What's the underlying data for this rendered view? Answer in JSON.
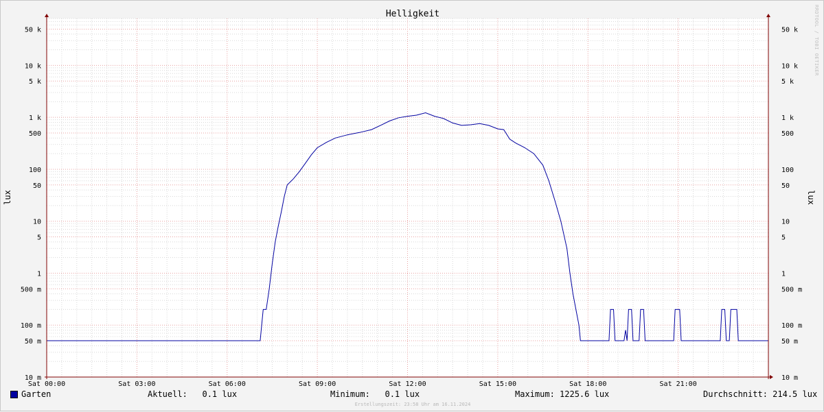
{
  "chart_data": {
    "type": "line",
    "title": "Helligkeit",
    "ylabel": "lux",
    "y_scale": "log",
    "ylim": [
      0.01,
      80000
    ],
    "xlim_hours": [
      0,
      24
    ],
    "x_ticks": [
      {
        "hour": 0,
        "label": "Sat 00:00"
      },
      {
        "hour": 3,
        "label": "Sat 03:00"
      },
      {
        "hour": 6,
        "label": "Sat 06:00"
      },
      {
        "hour": 9,
        "label": "Sat 09:00"
      },
      {
        "hour": 12,
        "label": "Sat 12:00"
      },
      {
        "hour": 15,
        "label": "Sat 15:00"
      },
      {
        "hour": 18,
        "label": "Sat 18:00"
      },
      {
        "hour": 21,
        "label": "Sat 21:00"
      }
    ],
    "y_ticks": [
      {
        "value": 50000,
        "label": "50 k"
      },
      {
        "value": 10000,
        "label": "10 k"
      },
      {
        "value": 5000,
        "label": "5 k"
      },
      {
        "value": 1000,
        "label": "1 k"
      },
      {
        "value": 500,
        "label": "500"
      },
      {
        "value": 100,
        "label": "100"
      },
      {
        "value": 50,
        "label": "50"
      },
      {
        "value": 10,
        "label": "10"
      },
      {
        "value": 5,
        "label": "5"
      },
      {
        "value": 1,
        "label": "1"
      },
      {
        "value": 0.5,
        "label": "500 m"
      },
      {
        "value": 0.1,
        "label": "100 m"
      },
      {
        "value": 0.05,
        "label": "50 m"
      },
      {
        "value": 0.01,
        "label": "10 m"
      }
    ],
    "grid": true,
    "series": [
      {
        "name": "Garten",
        "color": "#0000a0",
        "points": [
          [
            0.0,
            0.05
          ],
          [
            7.1,
            0.05
          ],
          [
            7.15,
            0.1
          ],
          [
            7.2,
            0.2
          ],
          [
            7.3,
            0.2
          ],
          [
            7.4,
            0.5
          ],
          [
            7.5,
            1.5
          ],
          [
            7.6,
            4
          ],
          [
            7.7,
            8
          ],
          [
            7.8,
            15
          ],
          [
            7.9,
            30
          ],
          [
            8.0,
            50
          ],
          [
            8.2,
            65
          ],
          [
            8.4,
            90
          ],
          [
            8.6,
            130
          ],
          [
            8.8,
            190
          ],
          [
            9.0,
            260
          ],
          [
            9.3,
            330
          ],
          [
            9.6,
            400
          ],
          [
            10.0,
            460
          ],
          [
            10.4,
            510
          ],
          [
            10.8,
            580
          ],
          [
            11.1,
            700
          ],
          [
            11.4,
            850
          ],
          [
            11.7,
            980
          ],
          [
            12.0,
            1050
          ],
          [
            12.3,
            1100
          ],
          [
            12.6,
            1225.6
          ],
          [
            12.9,
            1050
          ],
          [
            13.2,
            950
          ],
          [
            13.5,
            780
          ],
          [
            13.8,
            700
          ],
          [
            14.1,
            720
          ],
          [
            14.4,
            760
          ],
          [
            14.7,
            700
          ],
          [
            15.0,
            600
          ],
          [
            15.2,
            580
          ],
          [
            15.4,
            380
          ],
          [
            15.6,
            320
          ],
          [
            15.9,
            260
          ],
          [
            16.2,
            200
          ],
          [
            16.5,
            120
          ],
          [
            16.7,
            60
          ],
          [
            16.9,
            25
          ],
          [
            17.1,
            10
          ],
          [
            17.3,
            3
          ],
          [
            17.4,
            1
          ],
          [
            17.5,
            0.4
          ],
          [
            17.6,
            0.2
          ],
          [
            17.7,
            0.1
          ],
          [
            17.75,
            0.05
          ],
          [
            18.7,
            0.05
          ],
          [
            18.75,
            0.2
          ],
          [
            18.85,
            0.2
          ],
          [
            18.9,
            0.05
          ],
          [
            19.2,
            0.05
          ],
          [
            19.25,
            0.08
          ],
          [
            19.3,
            0.05
          ],
          [
            19.35,
            0.2
          ],
          [
            19.45,
            0.2
          ],
          [
            19.5,
            0.05
          ],
          [
            19.7,
            0.05
          ],
          [
            19.75,
            0.2
          ],
          [
            19.85,
            0.2
          ],
          [
            19.9,
            0.05
          ],
          [
            20.85,
            0.05
          ],
          [
            20.9,
            0.2
          ],
          [
            21.05,
            0.2
          ],
          [
            21.1,
            0.05
          ],
          [
            22.4,
            0.05
          ],
          [
            22.45,
            0.2
          ],
          [
            22.55,
            0.2
          ],
          [
            22.6,
            0.05
          ],
          [
            22.7,
            0.05
          ],
          [
            22.75,
            0.2
          ],
          [
            22.95,
            0.2
          ],
          [
            23.0,
            0.05
          ],
          [
            24.0,
            0.05
          ]
        ]
      }
    ]
  },
  "legend": {
    "series_name": "Garten",
    "current_label": "Aktuell:",
    "current_value": "0.1 lux",
    "minimum_label": "Minimum:",
    "minimum_value": "0.1 lux",
    "maximum_label": "Maximum:",
    "maximum_value": "1225.6 lux",
    "average_label": "Durchschnitt:",
    "average_value": "214.5 lux"
  },
  "footer": "Erstellungszeit: 23:58 Uhr am 16.11.2024",
  "watermark": "RRDTOOL / TOBI OETIKER",
  "colors": {
    "series": "#0000a0",
    "major_grid": "#e8a0a0",
    "minor_grid": "#d8d8d8",
    "axis": "#800000"
  }
}
